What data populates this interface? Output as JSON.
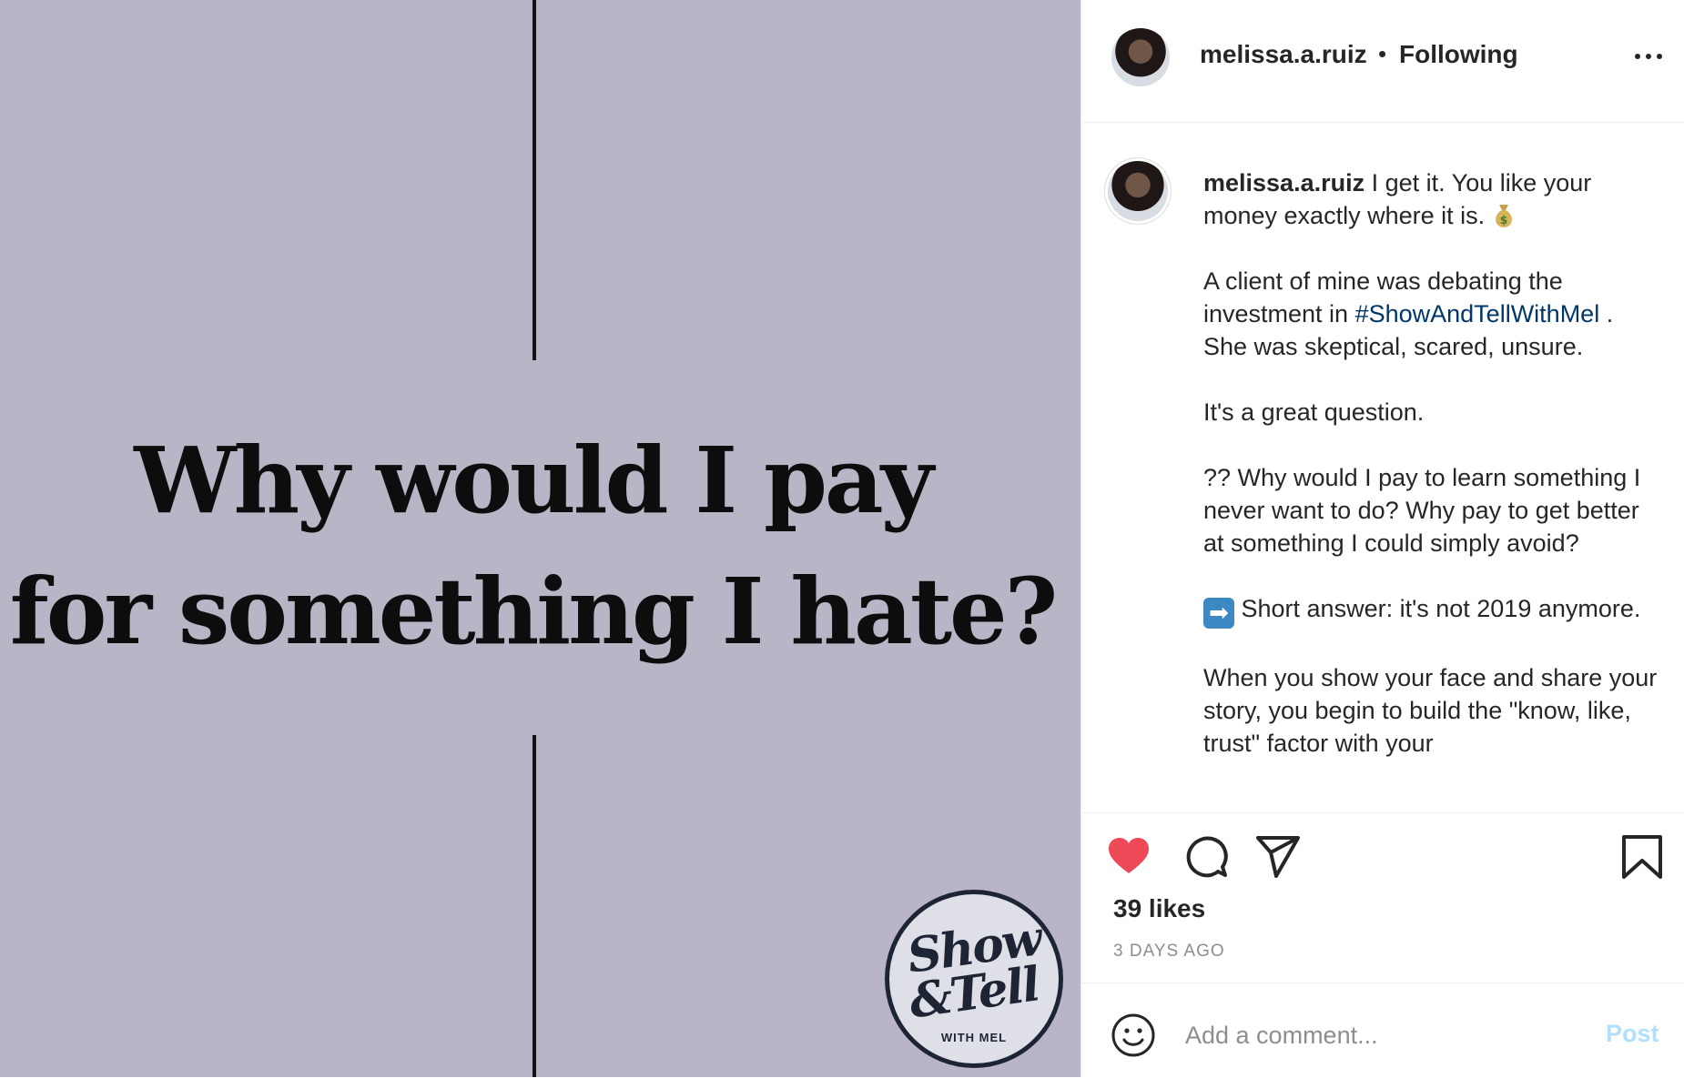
{
  "media": {
    "headline_line1": "Why would I pay",
    "headline_line2": "for something I hate?",
    "background_color": "#bab5c6",
    "logo": {
      "line1": "Show",
      "line2": "&Tell",
      "line3": "WITH MEL"
    }
  },
  "header": {
    "username": "melissa.a.ruiz",
    "separator": "•",
    "follow_status": "Following",
    "more_icon": "more-horizontal-icon"
  },
  "caption": {
    "username": "melissa.a.ruiz",
    "p1_text": " I get it. You like your money exactly where it is. ",
    "p1_emoji": "money-bag-icon",
    "p2_before": "A client of mine was debating the investment in ",
    "p2_hashtag": "#ShowAndTellWithMel",
    "p2_after": " . She was skeptical, scared, unsure.",
    "p3": "It's a great question.",
    "p4": "?? Why would I pay to learn something I never want to do? Why pay to get better at something I could simply avoid?",
    "p5_emoji": "➡",
    "p5_text": " Short answer: it's not 2019 anymore.",
    "p6": "When you show your face and share your story, you begin to build the \"know, like, trust\" factor with your"
  },
  "actions": {
    "like_icon": "heart-filled-icon",
    "comment_icon": "comment-icon",
    "share_icon": "share-icon",
    "save_icon": "bookmark-icon",
    "like_color": "#ed4956"
  },
  "likes": "39 likes",
  "timestamp": "3 DAYS AGO",
  "comment": {
    "placeholder": "Add a comment...",
    "post_label": "Post",
    "post_color": "#b2dffc"
  }
}
